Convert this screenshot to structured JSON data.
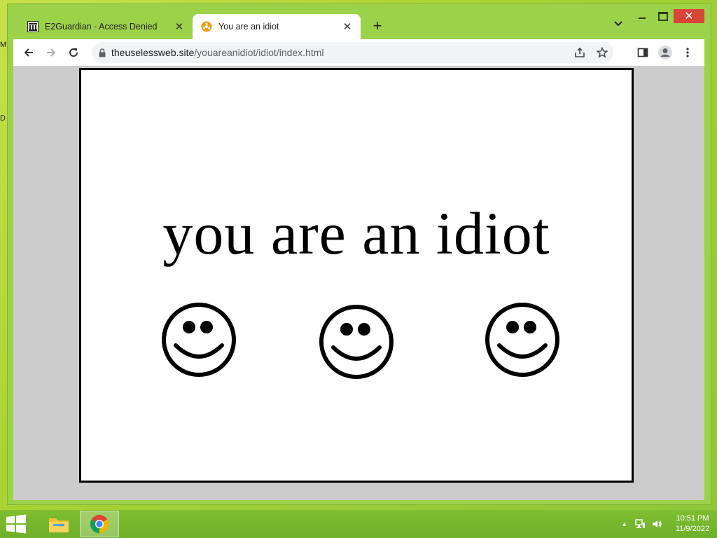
{
  "window": {
    "controls": {
      "minimize": "minimize",
      "maximize": "maximize",
      "close": "✕"
    }
  },
  "tabs": [
    {
      "title": "E2Guardian - Access Denied",
      "favicon": "bank-icon",
      "active": false
    },
    {
      "title": "You are an idiot",
      "favicon": "hazard-icon",
      "active": true
    }
  ],
  "toolbar": {
    "url_host": "theuselessweb.site",
    "url_path": "/youareanidiot/idiot/index.html"
  },
  "page": {
    "headline": "you are an idiot",
    "smiley_count": 3
  },
  "taskbar": {
    "time": "10:51 PM",
    "date": "11/9/2022"
  },
  "colors": {
    "desktop_accent": "#9cd14a",
    "close_button": "#d9453a",
    "page_border": "#000000"
  }
}
